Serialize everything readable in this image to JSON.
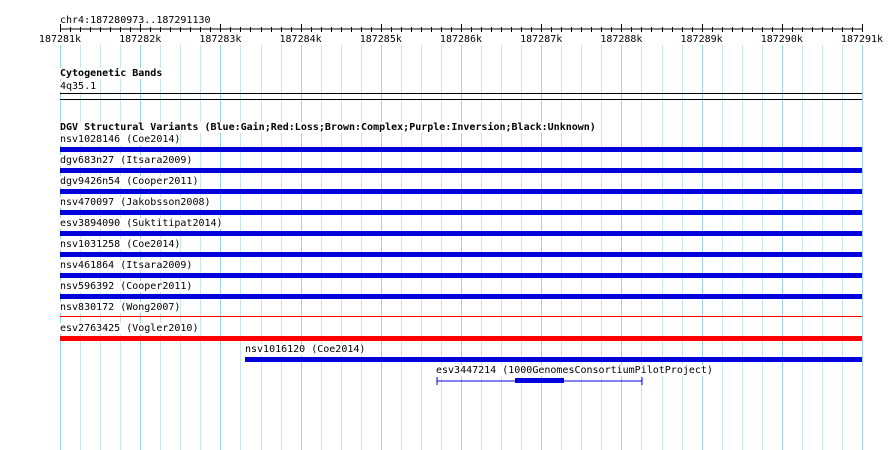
{
  "ruler": {
    "position_label": "chr4:187280973..187291130",
    "ticks": [
      "187281k",
      "187282k",
      "187283k",
      "187284k",
      "187285k",
      "187286k",
      "187287k",
      "187288k",
      "187289k",
      "187290k",
      "187291k"
    ]
  },
  "cytoband": {
    "title": "Cytogenetic Bands",
    "band": "4q35.1"
  },
  "dgv": {
    "title": "DGV Structural Variants (Blue:Gain;Red:Loss;Brown:Complex;Purple:Inversion;Black:Unknown)",
    "features": [
      {
        "label": "nsv1028146 (Coe2014)",
        "color": "#0000dd",
        "style": "full"
      },
      {
        "label": "dgv683n27 (Itsara2009)",
        "color": "#0000dd",
        "style": "full"
      },
      {
        "label": "dgv9426n54 (Cooper2011)",
        "color": "#0000dd",
        "style": "full"
      },
      {
        "label": "nsv470097 (Jakobsson2008)",
        "color": "#0000dd",
        "style": "full"
      },
      {
        "label": "esv3894090 (Suktitipat2014)",
        "color": "#0000dd",
        "style": "full"
      },
      {
        "label": "nsv1031258 (Coe2014)",
        "color": "#0000dd",
        "style": "full"
      },
      {
        "label": "nsv461864 (Itsara2009)",
        "color": "#0000dd",
        "style": "full"
      },
      {
        "label": "nsv596392 (Cooper2011)",
        "color": "#0000dd",
        "style": "full"
      },
      {
        "label": "nsv830172 (Wong2007)",
        "color": "#ff0000",
        "style": "thin"
      },
      {
        "label": "esv2763425 (Vogler2010)",
        "color": "#ff0000",
        "style": "full"
      },
      {
        "label": "nsv1016120 (Coe2014)",
        "color": "#0000dd",
        "style": "full"
      },
      {
        "label": "esv3447214 (1000GenomesConsortiumPilotProject)",
        "color": "#0000dd",
        "style": "gapped"
      }
    ]
  }
}
